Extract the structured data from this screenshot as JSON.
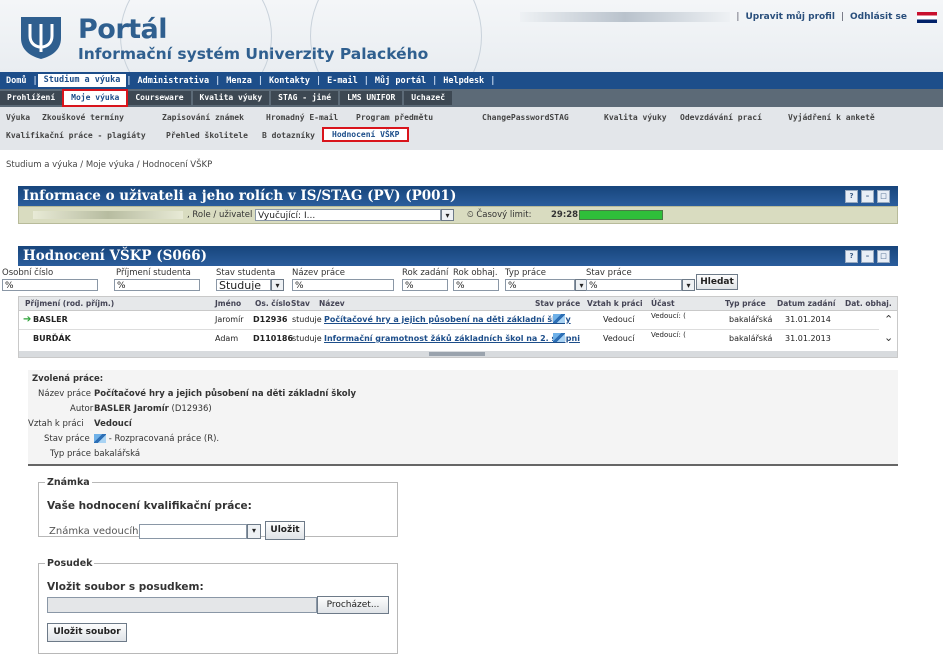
{
  "header": {
    "title": "Portál",
    "subtitle": "Informační systém Univerzity Palackého",
    "profile_link": "Upravit můj profil",
    "logout_link": "Odhlásit se"
  },
  "nav_main": [
    "Domů",
    "Studium a výuka",
    "Administrativa",
    "Menza",
    "Kontakty",
    "E-mail",
    "Můj portál",
    "Helpdesk"
  ],
  "nav_sub": [
    "Prohlížení",
    "Moje výuka",
    "Courseware",
    "Kvalita výuky",
    "STAG - jiné",
    "LMS UNIFOR",
    "Uchazeč"
  ],
  "nav_tabs_row1": [
    "Výuka",
    "Zkouškové termíny",
    "Zapisování známek",
    "Hromadný E-mail",
    "Program předmětu",
    "ChangePasswordSTAG",
    "Kvalita výuky",
    "Odevzdávání prací",
    "Vyjádření k anketě"
  ],
  "nav_tabs_row2": [
    "Kvalifikační práce - plagiáty",
    "Přehled školitele",
    "B dotazníky",
    "Hodnocení VŠKP"
  ],
  "breadcrumb": "Studium a výuka  /  Moje výuka  /  Hodnocení VŠKP",
  "info_panel": {
    "title": "Informace o uživateli a jeho rolích v IS/STAG (PV) (P001)",
    "role_label": ", Role / uživatel",
    "role_value": "Vyučující: I...",
    "time_label": "Časový limit:",
    "time_value": "29:28",
    "time_progress": 1.0
  },
  "eval_panel": {
    "title": "Hodnocení VŠKP (S066)",
    "filters": {
      "osobni_cislo": {
        "label": "Osobní číslo",
        "value": "%"
      },
      "prijmeni": {
        "label": "Příjmení studenta",
        "value": "%"
      },
      "stav_studenta": {
        "label": "Stav studenta",
        "value": "Studuje"
      },
      "nazev_prace": {
        "label": "Název práce",
        "value": "%"
      },
      "rok_zadani": {
        "label": "Rok zadání",
        "value": "%"
      },
      "rok_obhaj": {
        "label": "Rok obhaj.",
        "value": "%"
      },
      "typ_prace": {
        "label": "Typ práce",
        "value": "%"
      },
      "stav_prace": {
        "label": "Stav práce",
        "value": "%"
      },
      "search_button": "Hledat"
    },
    "columns": [
      "Příjmení (rod. příjm.)",
      "Jméno",
      "Os. číslo",
      "Stav",
      "Název",
      "Stav práce",
      "Vztah k práci",
      "Účast",
      "Typ práce",
      "Datum zadání",
      "Dat. obhaj."
    ],
    "rows": [
      {
        "prijmeni": "BASLER",
        "jmeno": "Jaromír",
        "os_cislo": "D12936",
        "stav": "studuje",
        "nazev": "Počítačové hry a jejich působení na děti základní školy",
        "vztah": "Vedoucí",
        "ucast": "Vedoucí: (",
        "typ": "bakalářská",
        "datum": "31.01.2014",
        "obhaj": ""
      },
      {
        "prijmeni": "BURĎÁK",
        "jmeno": "Adam",
        "os_cislo": "D110186",
        "stav": "studuje",
        "nazev": "Informační gramotnost žáků základních škol na 2. stupni",
        "vztah": "Vedoucí",
        "ucast": "Vedoucí: (",
        "typ": "bakalářská",
        "datum": "31.01.2013",
        "obhaj": ""
      }
    ]
  },
  "selected": {
    "heading": "Zvolená práce:",
    "labels": [
      "Název práce",
      "Autor",
      "Vztah k práci",
      "Stav práce",
      "Typ práce"
    ],
    "title": "Počítačové hry a jejich působení na děti základní školy",
    "author_name": "BASLER Jaromír",
    "author_id": "(D12936)",
    "relation": "Vedoucí",
    "state": "- Rozpracovaná práce (R).",
    "type": "bakalářská"
  },
  "grade": {
    "legend": "Známka",
    "heading": "Vaše hodnocení kvalifikační práce:",
    "label": "Známka vedoucího",
    "save_button": "Uložit"
  },
  "review": {
    "legend": "Posudek",
    "heading": "Vložit soubor s posudkem:",
    "browse_button": "Procházet...",
    "upload_button": "Uložit soubor"
  },
  "colors": {
    "accent": "#1d4e8a",
    "highlight": "#d9141c",
    "progress": "#2fbf3a"
  },
  "icons": [
    "university-logo-icon",
    "uk-flag-icon",
    "clock-icon",
    "help-icon",
    "minimize-icon",
    "maximize-icon",
    "row-arrow-icon",
    "scroll-up-icon",
    "scroll-down-icon",
    "work-state-icon",
    "dropdown-arrow-icon"
  ]
}
